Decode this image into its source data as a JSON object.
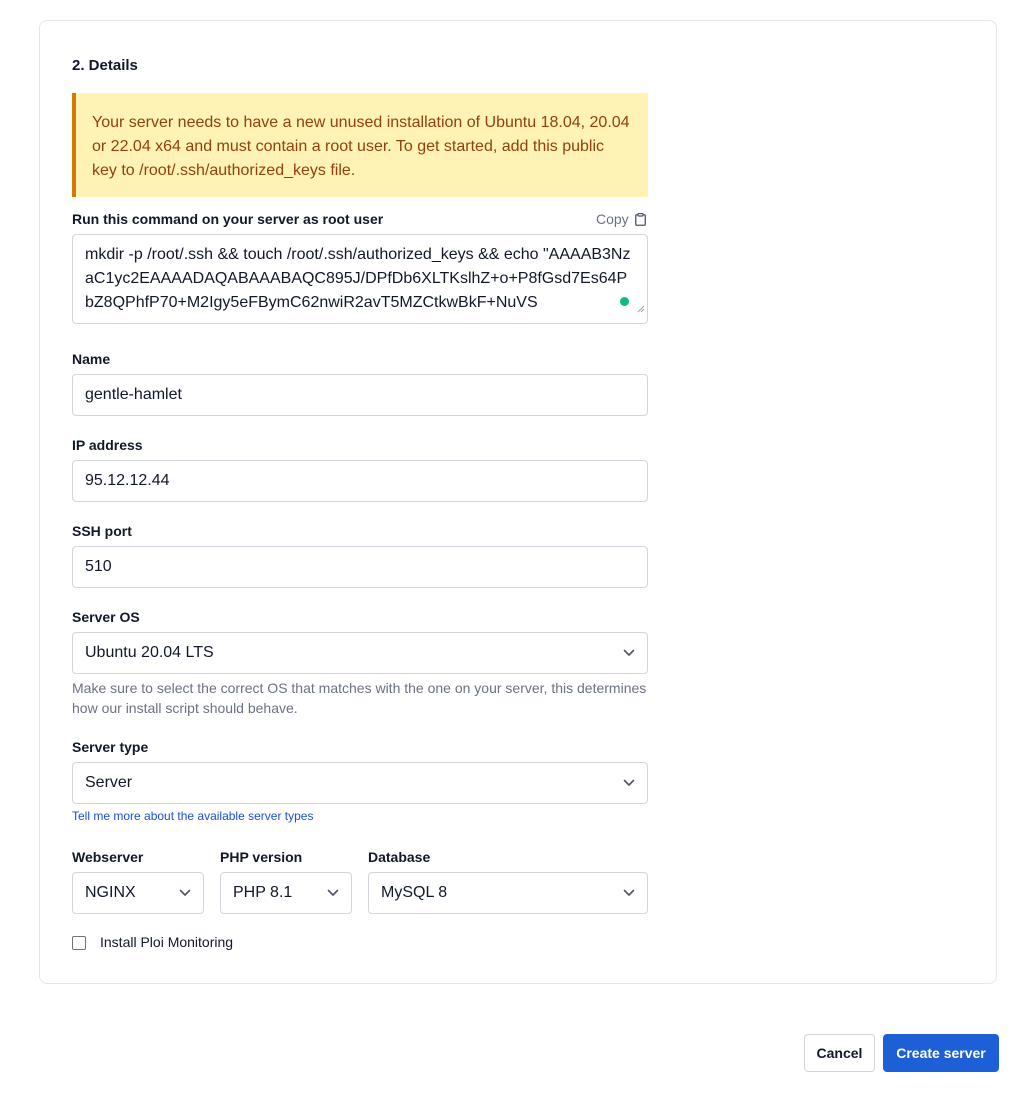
{
  "section": {
    "title": "2. Details"
  },
  "notice": {
    "text": "Your server needs to have a new unused installation of Ubuntu 18.04, 20.04 or 22.04 x64 and must contain a root user. To get started, add this public key to /root/.ssh/authorized_keys file."
  },
  "command": {
    "label": "Run this command on your server as root user",
    "copy_label": "Copy",
    "value": "mkdir -p /root/.ssh && touch /root/.ssh/authorized_keys && echo \"AAAAB3NzaC1yc2EAAAADAQABAAABAQC895J/DPfDb6XLTKslhZ+o+P8fGsd7Es64PbZ8QPhfP70+M2Igy5eFBymC62nwiR2avT5MZCtkwBkF+NuVS"
  },
  "fields": {
    "name": {
      "label": "Name",
      "value": "gentle-hamlet"
    },
    "ip": {
      "label": "IP address",
      "value": "95.12.12.44"
    },
    "ssh_port": {
      "label": "SSH port",
      "value": "510"
    },
    "server_os": {
      "label": "Server OS",
      "value": "Ubuntu 20.04 LTS",
      "help": "Make sure to select the correct OS that matches with the one on your server, this determines how our install script should behave."
    },
    "server_type": {
      "label": "Server type",
      "value": "Server",
      "link": "Tell me more about the available server types"
    },
    "webserver": {
      "label": "Webserver",
      "value": "NGINX"
    },
    "php": {
      "label": "PHP version",
      "value": "PHP 8.1"
    },
    "database": {
      "label": "Database",
      "value": "MySQL 8"
    },
    "monitoring": {
      "label": "Install Ploi Monitoring",
      "checked": false
    }
  },
  "actions": {
    "cancel": "Cancel",
    "create": "Create server"
  },
  "colors": {
    "primary": "#1d5fd6",
    "notice_bg": "#fef3b4",
    "notice_border": "#d97706",
    "notice_text": "#92400e"
  }
}
